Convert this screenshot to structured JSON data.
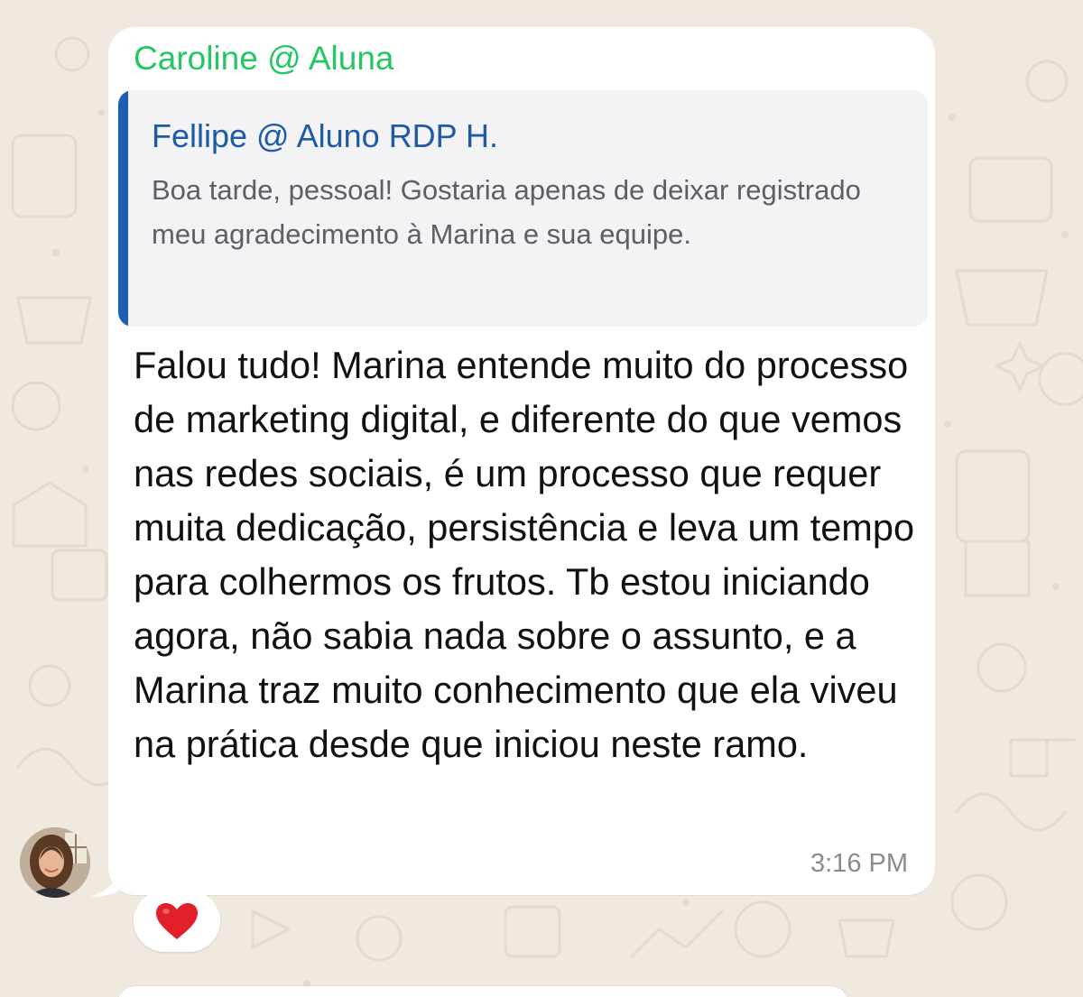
{
  "message": {
    "sender_name": "Caroline @ Aluna",
    "quoted": {
      "author": "Fellipe @ Aluno RDP H.",
      "text": "Boa tarde, pessoal! Gostaria apenas de deixar registrado meu agradecimento à Marina e sua equipe."
    },
    "body": "Falou tudo! Marina entende muito do processo de marketing digital, e diferente do que vemos nas redes sociais, é um processo que requer muita dedicação, persistência e leva um tempo para colhermos os frutos. Tb estou iniciando agora, não sabia nada sobre o assunto, e a Marina traz muito conhecimento que ela viveu na prática desde que iniciou neste ramo.",
    "time": "3:16 PM",
    "reaction": "heart-icon"
  },
  "colors": {
    "sender_name": "#25c763",
    "quote_author": "#1e5ba5",
    "quote_bar": "#1e5fb4",
    "reaction_heart": "#e2202c",
    "background": "#efe9df"
  }
}
